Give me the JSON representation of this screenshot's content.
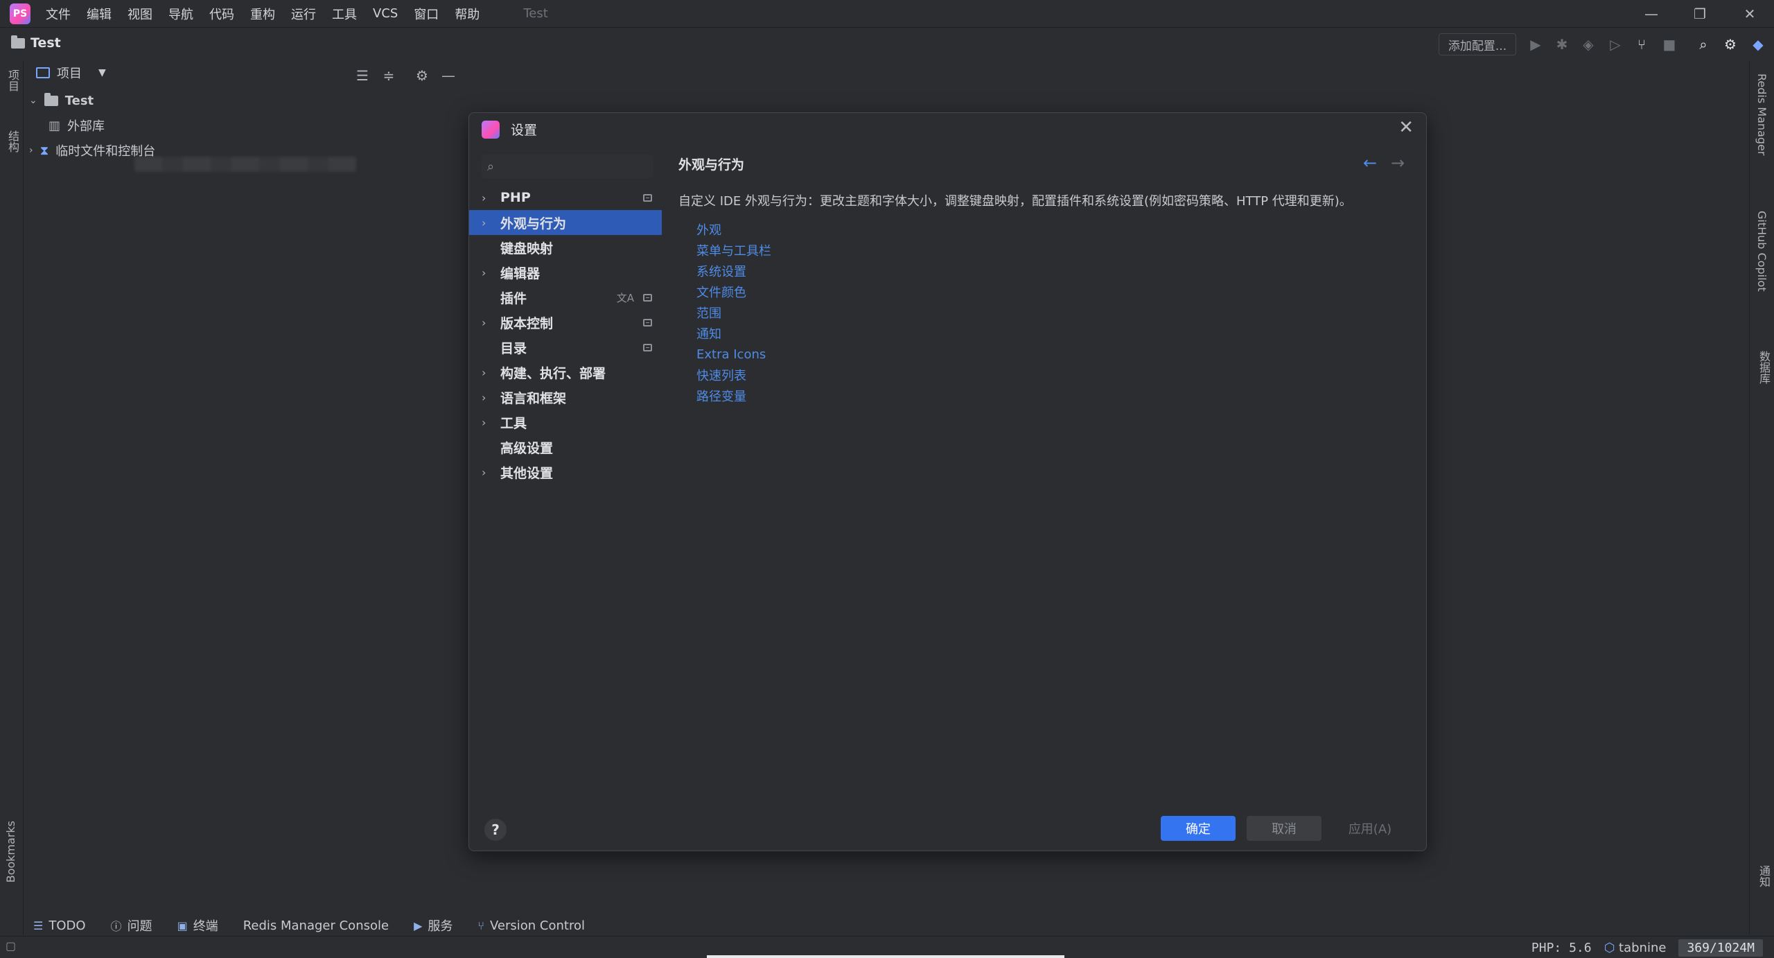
{
  "menu": {
    "items": [
      "文件",
      "编辑",
      "视图",
      "导航",
      "代码",
      "重构",
      "运行",
      "工具",
      "VCS",
      "窗口",
      "帮助"
    ],
    "window_title": "Test"
  },
  "toolbar": {
    "project_name": "Test",
    "add_config_label": "添加配置..."
  },
  "left_stripe": {
    "project_label": "项目",
    "structure_label": "结构",
    "bookmarks_label": "Bookmarks"
  },
  "project_panel": {
    "header_label": "项目",
    "tree": [
      {
        "label": "Test",
        "expanded": true
      },
      {
        "label": "外部库"
      },
      {
        "label": "临时文件和控制台"
      }
    ]
  },
  "right_stripe": {
    "redis_label": "Redis Manager",
    "copilot_label": "GitHub Copilot",
    "database_label": "数据库",
    "notifications_label": "通知"
  },
  "dialog": {
    "title": "设置",
    "search_placeholder": "",
    "nav": [
      {
        "label": "PHP",
        "chevron": true,
        "badge": true
      },
      {
        "label": "外观与行为",
        "chevron": true,
        "selected": true
      },
      {
        "label": "键盘映射"
      },
      {
        "label": "编辑器",
        "chevron": true
      },
      {
        "label": "插件",
        "badge": true,
        "translate": true
      },
      {
        "label": "版本控制",
        "chevron": true,
        "badge": true
      },
      {
        "label": "目录",
        "badge": true
      },
      {
        "label": "构建、执行、部署",
        "chevron": true
      },
      {
        "label": "语言和框架",
        "chevron": true
      },
      {
        "label": "工具",
        "chevron": true
      },
      {
        "label": "高级设置"
      },
      {
        "label": "其他设置",
        "chevron": true
      }
    ],
    "content": {
      "title": "外观与行为",
      "description": "自定义 IDE 外观与行为：更改主题和字体大小，调整键盘映射，配置插件和系统设置(例如密码策略、HTTP 代理和更新)。",
      "links": [
        "外观",
        "菜单与工具栏",
        "系统设置",
        "文件颜色",
        "范围",
        "通知",
        "Extra Icons",
        "快速列表",
        "路径变量"
      ]
    },
    "buttons": {
      "help": "?",
      "ok": "确定",
      "cancel": "取消",
      "apply": "应用(A)"
    }
  },
  "bottom_tabs": [
    "TODO",
    "问题",
    "终端",
    "Redis Manager Console",
    "服务",
    "Version Control"
  ],
  "status": {
    "php": "PHP: 5.6",
    "tabnine": "tabnine",
    "memory": "369/1024M"
  },
  "colors": {
    "accent": "#3574f0",
    "selection": "#2e5bb5",
    "link": "#4f8be6",
    "background": "#2b2d30"
  }
}
